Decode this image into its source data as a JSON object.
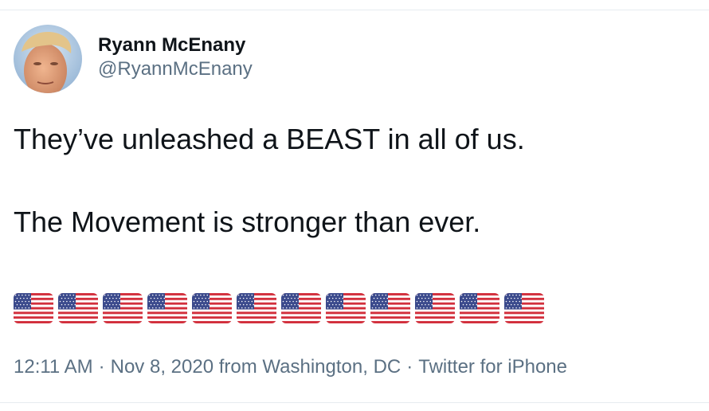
{
  "tweet": {
    "display_name": "Ryann McEnany",
    "handle": "@RyannMcEnany",
    "text_line_1": "They’ve unleashed a BEAST in all of us.",
    "text_line_2": "The Movement is stronger than ever.",
    "flag_count": 12,
    "flag_icon": "us-flag-emoji",
    "time": "12:11 AM",
    "date": "Nov 8, 2020",
    "location": "from Washington, DC",
    "source": "Twitter for iPhone",
    "separator": "·"
  },
  "colors": {
    "text": "#0f1419",
    "secondary": "#5b7083",
    "divider": "#e6ecf0"
  }
}
